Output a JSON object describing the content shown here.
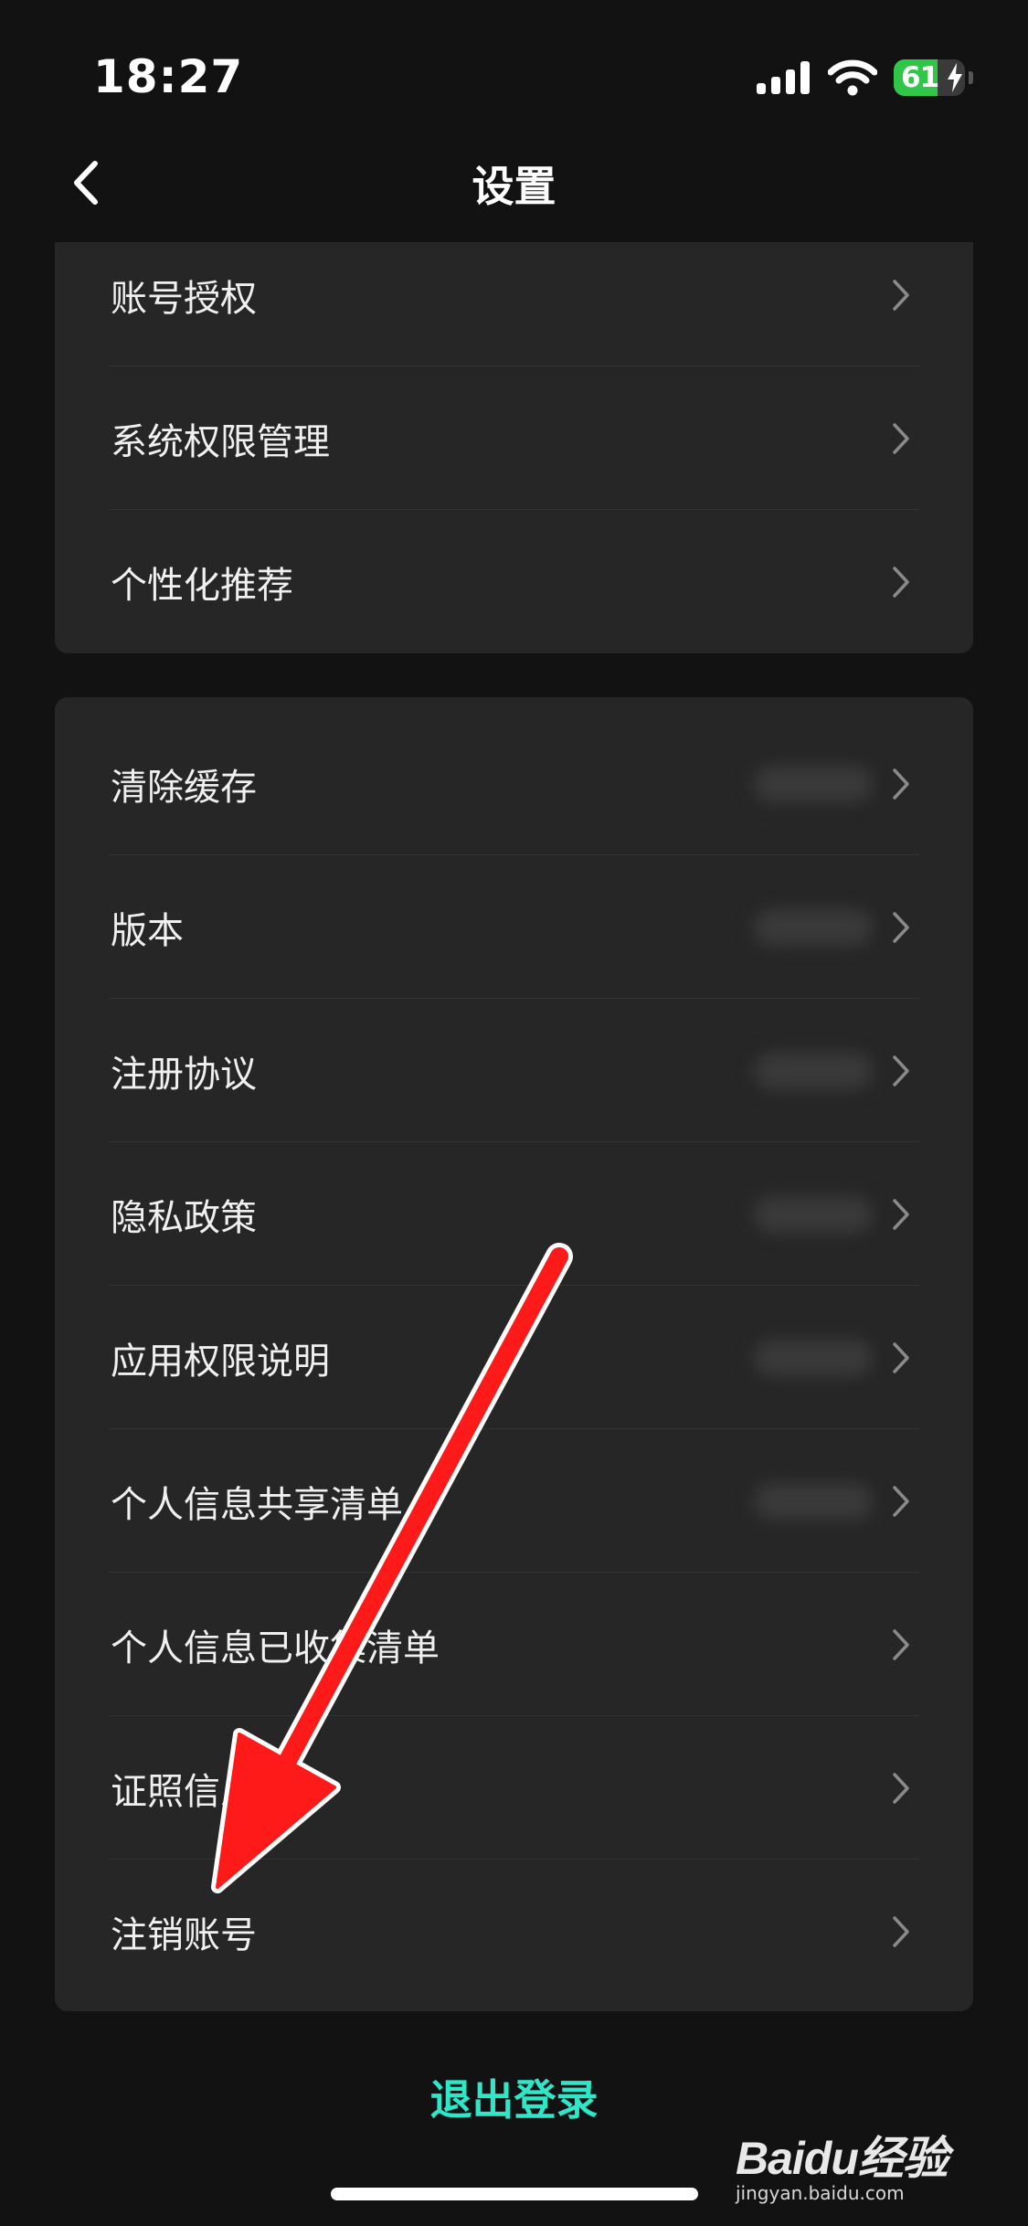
{
  "status_bar": {
    "time": "18:27",
    "battery_percent": "61",
    "battery_level": 0.61,
    "signal_icon": "cellular-signal-icon",
    "wifi_icon": "wifi-icon",
    "charging_icon": "charging-bolt-icon"
  },
  "nav": {
    "title": "设置",
    "back_icon": "chevron-left-icon"
  },
  "sections": [
    {
      "items": [
        {
          "label": "账号授权",
          "has_value": false
        },
        {
          "label": "系统权限管理",
          "has_value": false
        },
        {
          "label": "个性化推荐",
          "has_value": false
        }
      ]
    },
    {
      "items": [
        {
          "label": "清除缓存",
          "has_value": true
        },
        {
          "label": "版本",
          "has_value": true
        },
        {
          "label": "注册协议",
          "has_value": true
        },
        {
          "label": "隐私政策",
          "has_value": true
        },
        {
          "label": "应用权限说明",
          "has_value": true
        },
        {
          "label": "个人信息共享清单",
          "has_value": true
        },
        {
          "label": "个人信息已收集清单",
          "has_value": false
        },
        {
          "label": "证照信息",
          "has_value": false
        },
        {
          "label": "注销账号",
          "has_value": false
        }
      ]
    }
  ],
  "logout_label": "退出登录",
  "watermark": {
    "brand": "Baidu经验",
    "url": "jingyan.baidu.com"
  },
  "colors": {
    "background": "#121212",
    "card": "#262626",
    "accent": "#2ee6c8",
    "annotation": "#ff1a1a",
    "battery": "#30c749"
  }
}
